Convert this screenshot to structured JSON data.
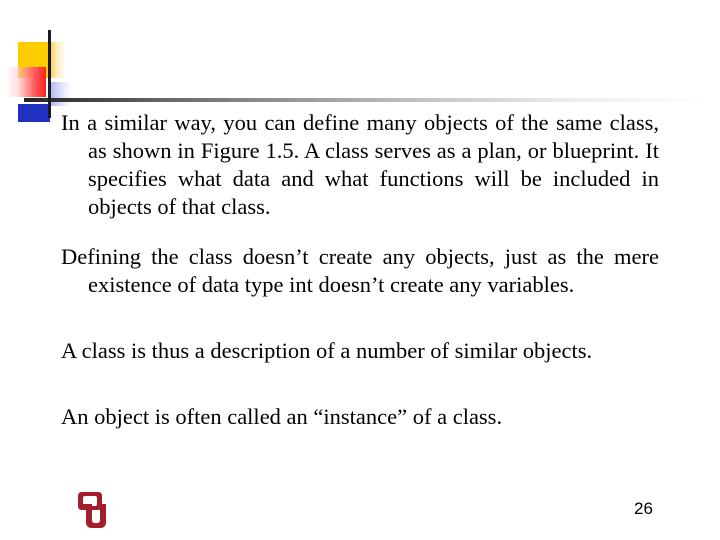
{
  "slide": {
    "paragraphs": [
      "In a similar way, you can define many objects of the same class, as shown in Figure 1.5. A class serves as a plan, or blueprint. It specifies what data and what functions will be included in objects of that class.",
      "Defining the class doesn’t create any objects, just as the mere existence of data type int doesn’t create any variables.",
      "A class is thus a description of a number of similar objects.",
      "An object is often called an “instance” of a class."
    ],
    "page_number": "26",
    "logo": {
      "name": "OU interlocking monogram",
      "color": "#a31d2d"
    },
    "decoration_colors": {
      "yellow": "#ffc000",
      "red": "#ff2020",
      "blue": "#2030c0",
      "line": "#222222"
    }
  }
}
